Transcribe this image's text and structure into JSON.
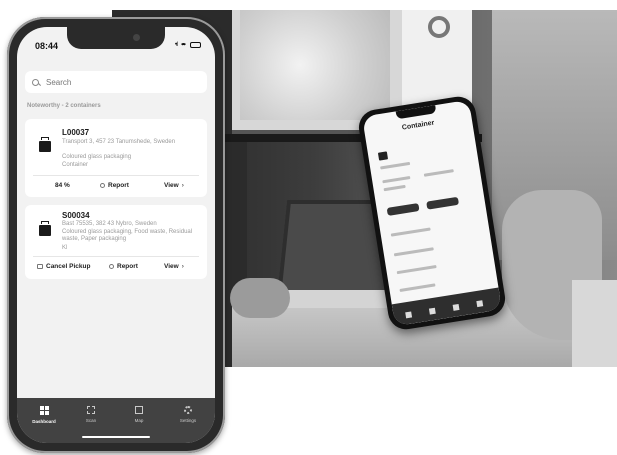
{
  "status_bar": {
    "time": "08:44",
    "signal": "•ıl"
  },
  "search": {
    "placeholder": "Search"
  },
  "section_title": "Noteworthy - 2 containers",
  "cards": [
    {
      "id": "L00037",
      "address": "Transport 3, 457 23 Tanumshede, Sweden",
      "description": "Coloured glass packaging",
      "type": "Container",
      "fill_level": "84 %",
      "report_label": "Report",
      "view_label": "View"
    },
    {
      "id": "S00034",
      "address": "Bast 75535, 382 43 Nybro, Sweden",
      "description": "Coloured glass packaging, Food waste, Residual waste, Paper packaging",
      "type": "Kl",
      "cancel_label": "Cancel Pickup",
      "report_label": "Report",
      "view_label": "View"
    }
  ],
  "tabs": [
    {
      "label": "Dashboard",
      "icon": "dashboard-icon",
      "active": true
    },
    {
      "label": "Scan",
      "icon": "scan-icon",
      "active": false
    },
    {
      "label": "Map",
      "icon": "map-icon",
      "active": false
    },
    {
      "label": "Settings",
      "icon": "gear-icon",
      "active": false
    }
  ],
  "background_phone": {
    "title": "Container"
  },
  "colors": {
    "tabbar": "#424242",
    "screen_bg": "#f2f2f2",
    "card_bg": "#ffffff",
    "muted_text": "#9b9b9b"
  }
}
